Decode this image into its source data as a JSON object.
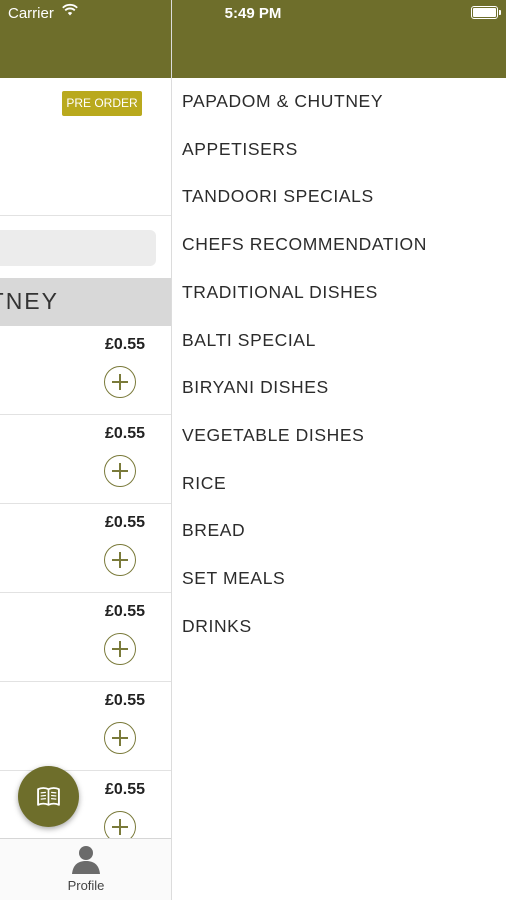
{
  "status_bar": {
    "carrier": "Carrier",
    "time": "5:49 PM"
  },
  "icons": {
    "wifi": "wifi-icon",
    "battery": "battery-icon",
    "add": "add-circle-icon",
    "menu_book": "book-icon",
    "profile": "person-icon"
  },
  "colors": {
    "header": "#6e6e2b",
    "badge": "#b9a91d",
    "accent": "#7a7a3a"
  },
  "left_panel": {
    "pre_order_label": "PRE ORDER",
    "category_title": "PAPADOM & CHUTNEY",
    "items": [
      {
        "price": "£0.55"
      },
      {
        "price": "£0.55"
      },
      {
        "price": "£0.55"
      },
      {
        "price": "£0.55"
      },
      {
        "price": "£0.55"
      },
      {
        "price": "£0.55"
      }
    ]
  },
  "tabbar": {
    "profile_label": "Profile"
  },
  "drawer": {
    "items": [
      {
        "label": "PAPADOM & CHUTNEY"
      },
      {
        "label": "APPETISERS"
      },
      {
        "label": "TANDOORI SPECIALS"
      },
      {
        "label": "CHEFS RECOMMENDATION"
      },
      {
        "label": "TRADITIONAL DISHES"
      },
      {
        "label": "BALTI SPECIAL"
      },
      {
        "label": "BIRYANI DISHES"
      },
      {
        "label": "VEGETABLE DISHES"
      },
      {
        "label": "RICE"
      },
      {
        "label": "BREAD"
      },
      {
        "label": "SET MEALS"
      },
      {
        "label": "DRINKS"
      }
    ]
  }
}
